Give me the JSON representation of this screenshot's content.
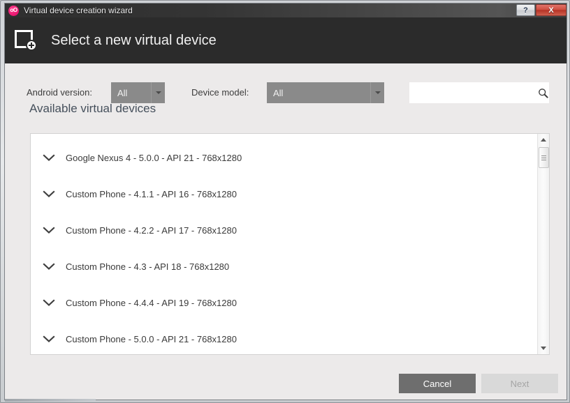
{
  "window": {
    "title": "Virtual device creation wizard",
    "app_icon": "genymotion-icon",
    "app_icon_text": "oO",
    "help_label": "?",
    "close_label": "X"
  },
  "header": {
    "title": "Select a new virtual device",
    "icon": "new-device-icon"
  },
  "filters": {
    "android_version": {
      "label": "Android version:",
      "value": "All"
    },
    "device_model": {
      "label": "Device model:",
      "value": "All"
    },
    "search": {
      "value": "",
      "placeholder": "",
      "icon": "search-icon"
    }
  },
  "list": {
    "section_title": "Available virtual devices",
    "devices": [
      {
        "label": "Google Nexus 4 - 5.0.0 - API 21 - 768x1280"
      },
      {
        "label": "Custom Phone - 4.1.1 - API 16 - 768x1280"
      },
      {
        "label": "Custom Phone - 4.2.2 - API 17 - 768x1280"
      },
      {
        "label": "Custom Phone - 4.3 - API 18 - 768x1280"
      },
      {
        "label": "Custom Phone - 4.4.4 - API 19 - 768x1280"
      },
      {
        "label": "Custom Phone - 5.0.0 - API 21 - 768x1280"
      }
    ]
  },
  "footer": {
    "cancel_label": "Cancel",
    "next_label": "Next"
  },
  "colors": {
    "header_bg": "#2b2b2b",
    "panel_bg": "#eceaea",
    "accent_pink": "#e8166f",
    "dropdown_bg": "#8a8a8a",
    "cancel_bg": "#6e6e6e",
    "next_bg": "#d9d9d9",
    "section_title": "#46505c"
  }
}
